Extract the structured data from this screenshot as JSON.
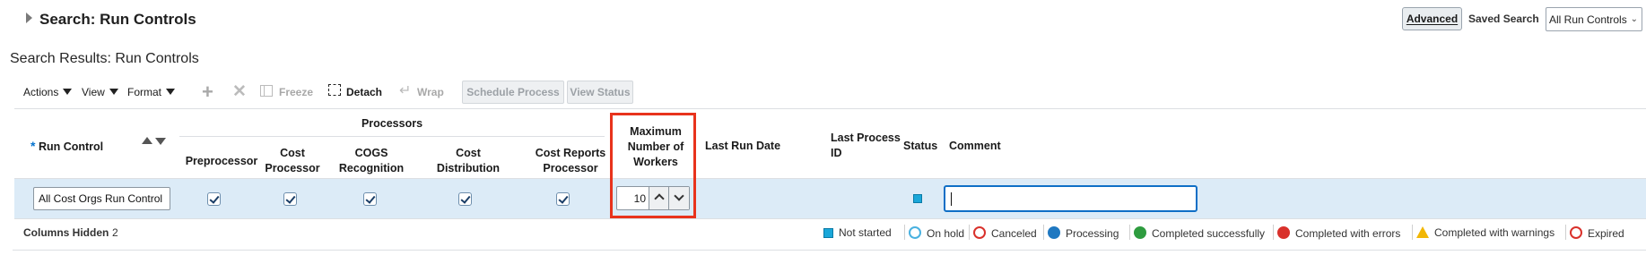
{
  "header": {
    "title": "Search: Run Controls",
    "advanced_label": "Advanced",
    "saved_search_label": "Saved Search",
    "saved_search_value": "All Run Controls"
  },
  "results_title": "Search Results: Run Controls",
  "toolbar": {
    "actions": "Actions",
    "view": "View",
    "format": "Format",
    "freeze": "Freeze",
    "detach": "Detach",
    "wrap": "Wrap",
    "schedule_process": "Schedule Process",
    "view_status": "View Status"
  },
  "table": {
    "headers": {
      "run_control": "Run Control",
      "processors_group": "Processors",
      "preprocessor": "Preprocessor",
      "cost_processor": "Cost Processor",
      "cogs_recognition": "COGS Recognition",
      "cost_distribution": "Cost Distribution",
      "cost_reports_processor": "Cost Reports Processor",
      "max_workers": "Maximum Number of Workers",
      "last_run_date": "Last Run Date",
      "last_process_id": "Last Process ID",
      "status": "Status",
      "comment": "Comment"
    },
    "row": {
      "run_control": "All Cost Orgs Run Control",
      "preprocessor": true,
      "cost_processor": true,
      "cogs_recognition": true,
      "cost_distribution": true,
      "cost_reports_processor": true,
      "max_workers": "10",
      "last_run_date": "",
      "last_process_id": "",
      "status": "Not started",
      "comment": ""
    }
  },
  "footer": {
    "columns_hidden_label": "Columns Hidden",
    "columns_hidden_count": "2",
    "legend": [
      {
        "label": "Not started",
        "icon": "square-blue",
        "color": "#1aa7d9"
      },
      {
        "label": "On hold",
        "icon": "pause-circle",
        "color": "#49b1e0"
      },
      {
        "label": "Canceled",
        "icon": "ban-circle",
        "color": "#d9312b"
      },
      {
        "label": "Processing",
        "icon": "clock-circle",
        "color": "#1f78c1"
      },
      {
        "label": "Completed successfully",
        "icon": "check-circle",
        "color": "#2e9c3f"
      },
      {
        "label": "Completed with errors",
        "icon": "x-circle",
        "color": "#d9312b"
      },
      {
        "label": "Completed with warnings",
        "icon": "warning-triangle",
        "color": "#f2b705"
      },
      {
        "label": "Expired",
        "icon": "ban-circle",
        "color": "#d9312b"
      }
    ]
  }
}
